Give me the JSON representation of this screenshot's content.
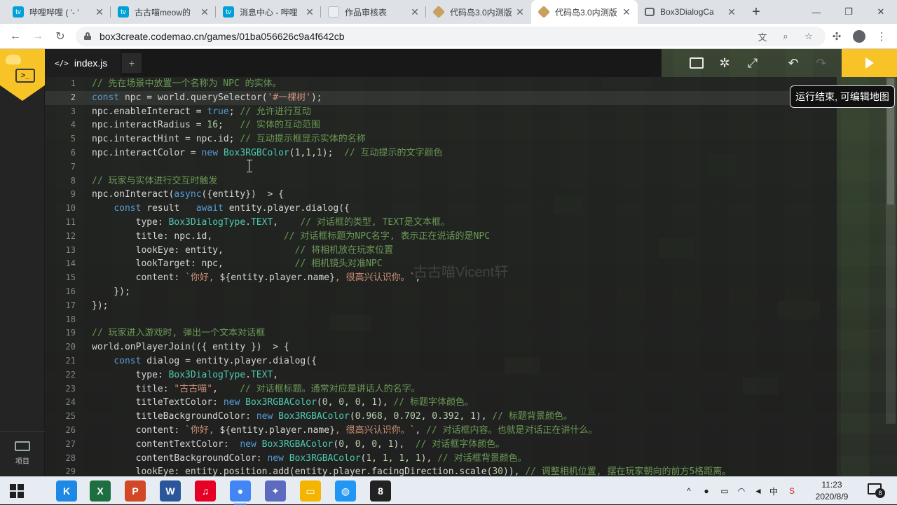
{
  "browser": {
    "tabs": [
      {
        "title": "哔哩哔哩 ( '- '",
        "icon": "bilibili-icon",
        "color": "#00a1d6"
      },
      {
        "title": "古古喵meow的",
        "icon": "bilibili-icon",
        "color": "#00a1d6"
      },
      {
        "title": "消息中心 - 哔哩",
        "icon": "bilibili-icon",
        "color": "#00a1d6"
      },
      {
        "title": "作品审核表",
        "icon": "document-icon",
        "color": "#cfd8dc"
      },
      {
        "title": "代码岛3.0内测版",
        "icon": "box3-icon",
        "color": "#c8a060"
      },
      {
        "title": "代码岛3.0内测版",
        "icon": "box3-icon",
        "color": "#c8a060"
      },
      {
        "title": "Box3DialogCa",
        "icon": "book-icon",
        "color": "#5f6368"
      }
    ],
    "url": "box3create.codemao.cn/games/01ba056626c9a4f642cb"
  },
  "editor": {
    "file_tab": "index.js",
    "file_tab_add": "+",
    "tooltip": "运行结束, 可编辑地图",
    "watermark": "古古喵Vicent轩",
    "left_rail_label": "项目",
    "lines": [
      {
        "n": "1",
        "segs": [
          [
            "cm",
            "// 先在场景中放置一个名称为 NPC 的实体。"
          ]
        ]
      },
      {
        "n": "2",
        "segs": [
          [
            "kw",
            "const"
          ],
          [
            "",
            " npc = world.querySelector("
          ],
          [
            "str",
            "'#一棵树'"
          ],
          [
            "",
            ");"
          ]
        ]
      },
      {
        "n": "3",
        "segs": [
          [
            "",
            "npc.enableInteract = "
          ],
          [
            "kw",
            "true"
          ],
          [
            "",
            "; "
          ],
          [
            "cm",
            "// 允许进行互动"
          ]
        ]
      },
      {
        "n": "4",
        "segs": [
          [
            "",
            "npc.interactRadius = "
          ],
          [
            "num",
            "16"
          ],
          [
            "",
            ";   "
          ],
          [
            "cm",
            "// 实体的互动范围"
          ]
        ]
      },
      {
        "n": "5",
        "segs": [
          [
            "",
            "npc.interactHint = npc.id; "
          ],
          [
            "cm",
            "// 互动提示框显示实体的名称"
          ]
        ]
      },
      {
        "n": "6",
        "segs": [
          [
            "",
            "npc.interactColor = "
          ],
          [
            "kw",
            "new"
          ],
          [
            "",
            " "
          ],
          [
            "ty",
            "Box3RGBColor"
          ],
          [
            "",
            "("
          ],
          [
            "num",
            "1"
          ],
          [
            "",
            ","
          ],
          [
            "num",
            "1"
          ],
          [
            "",
            ","
          ],
          [
            "num",
            "1"
          ],
          [
            "",
            ");  "
          ],
          [
            "cm",
            "// 互动提示的文字颜色"
          ]
        ]
      },
      {
        "n": "7",
        "segs": [
          [
            "",
            ""
          ]
        ]
      },
      {
        "n": "8",
        "segs": [
          [
            "cm",
            "// 玩家与实体进行交互时触发"
          ]
        ]
      },
      {
        "n": "9",
        "segs": [
          [
            "",
            "npc.onInteract("
          ],
          [
            "kw",
            "async"
          ],
          [
            "",
            "({entity})  > {"
          ]
        ]
      },
      {
        "n": "10",
        "segs": [
          [
            "",
            "    "
          ],
          [
            "kw",
            "const"
          ],
          [
            "",
            " result   "
          ],
          [
            "kw",
            "await"
          ],
          [
            "",
            " entity.player.dialog({"
          ]
        ]
      },
      {
        "n": "11",
        "segs": [
          [
            "",
            "        type: "
          ],
          [
            "ty",
            "Box3DialogType"
          ],
          [
            "",
            "."
          ],
          [
            "ty",
            "TEXT"
          ],
          [
            "",
            ",    "
          ],
          [
            "cm",
            "// 对话框的类型, TEXT是文本框。"
          ]
        ]
      },
      {
        "n": "12",
        "segs": [
          [
            "",
            "        title: npc.id,             "
          ],
          [
            "cm",
            "// 对话框标题为NPC名字, 表示正在说话的是NPC"
          ]
        ]
      },
      {
        "n": "13",
        "segs": [
          [
            "",
            "        lookEye: entity,             "
          ],
          [
            "cm",
            "// 将相机放在玩家位置"
          ]
        ]
      },
      {
        "n": "14",
        "segs": [
          [
            "",
            "        lookTarget: npc,             "
          ],
          [
            "cm",
            "// 相机镜头对准NPC"
          ]
        ]
      },
      {
        "n": "15",
        "segs": [
          [
            "",
            "        content: "
          ],
          [
            "str",
            "`你好, "
          ],
          [
            "",
            "${entity.player.name}"
          ],
          [
            "str",
            ", 很高兴认识你。`"
          ],
          [
            "",
            ","
          ]
        ]
      },
      {
        "n": "16",
        "segs": [
          [
            "",
            "    });"
          ]
        ]
      },
      {
        "n": "17",
        "segs": [
          [
            "",
            "});"
          ]
        ]
      },
      {
        "n": "18",
        "segs": [
          [
            "",
            ""
          ]
        ]
      },
      {
        "n": "19",
        "segs": [
          [
            "cm",
            "// 玩家进入游戏时, 弹出一个文本对话框"
          ]
        ]
      },
      {
        "n": "20",
        "segs": [
          [
            "",
            "world.onPlayerJoin(({ entity })  > {"
          ]
        ]
      },
      {
        "n": "21",
        "segs": [
          [
            "",
            "    "
          ],
          [
            "kw",
            "const"
          ],
          [
            "",
            " dialog = entity.player.dialog({"
          ]
        ]
      },
      {
        "n": "22",
        "segs": [
          [
            "",
            "        type: "
          ],
          [
            "ty",
            "Box3DialogType"
          ],
          [
            "",
            "."
          ],
          [
            "ty",
            "TEXT"
          ],
          [
            "",
            ","
          ]
        ]
      },
      {
        "n": "23",
        "segs": [
          [
            "",
            "        title: "
          ],
          [
            "str",
            "\"古古喵\""
          ],
          [
            "",
            ",    "
          ],
          [
            "cm",
            "// 对话框标题。通常对应是讲话人的名字。"
          ]
        ]
      },
      {
        "n": "24",
        "segs": [
          [
            "",
            "        titleTextColor: "
          ],
          [
            "kw",
            "new"
          ],
          [
            "",
            " "
          ],
          [
            "ty",
            "Box3RGBAColor"
          ],
          [
            "",
            "("
          ],
          [
            "num",
            "0"
          ],
          [
            "",
            ", "
          ],
          [
            "num",
            "0"
          ],
          [
            "",
            ", "
          ],
          [
            "num",
            "0"
          ],
          [
            "",
            ", "
          ],
          [
            "num",
            "1"
          ],
          [
            "",
            "), "
          ],
          [
            "cm",
            "// 标题字体颜色。"
          ]
        ]
      },
      {
        "n": "25",
        "segs": [
          [
            "",
            "        titleBackgroundColor: "
          ],
          [
            "kw",
            "new"
          ],
          [
            "",
            " "
          ],
          [
            "ty",
            "Box3RGBAColor"
          ],
          [
            "",
            "("
          ],
          [
            "num",
            "0.968"
          ],
          [
            "",
            ", "
          ],
          [
            "num",
            "0.702"
          ],
          [
            "",
            ", "
          ],
          [
            "num",
            "0.392"
          ],
          [
            "",
            ", "
          ],
          [
            "num",
            "1"
          ],
          [
            "",
            "), "
          ],
          [
            "cm",
            "// 标题背景颜色。"
          ]
        ]
      },
      {
        "n": "26",
        "segs": [
          [
            "",
            "        content: "
          ],
          [
            "str",
            "`你好, "
          ],
          [
            "",
            "${entity.player.name}"
          ],
          [
            "str",
            ", 很高兴认识你。`"
          ],
          [
            "",
            ", "
          ],
          [
            "cm",
            "// 对话框内容。也就是对话正在讲什么。"
          ]
        ]
      },
      {
        "n": "27",
        "segs": [
          [
            "",
            "        contentTextColor:  "
          ],
          [
            "kw",
            "new"
          ],
          [
            "",
            " "
          ],
          [
            "ty",
            "Box3RGBAColor"
          ],
          [
            "",
            "("
          ],
          [
            "num",
            "0"
          ],
          [
            "",
            ", "
          ],
          [
            "num",
            "0"
          ],
          [
            "",
            ", "
          ],
          [
            "num",
            "0"
          ],
          [
            "",
            ", "
          ],
          [
            "num",
            "1"
          ],
          [
            "",
            "),  "
          ],
          [
            "cm",
            "// 对话框字体颜色。"
          ]
        ]
      },
      {
        "n": "28",
        "segs": [
          [
            "",
            "        contentBackgroundColor: "
          ],
          [
            "kw",
            "new"
          ],
          [
            "",
            " "
          ],
          [
            "ty",
            "Box3RGBAColor"
          ],
          [
            "",
            "("
          ],
          [
            "num",
            "1"
          ],
          [
            "",
            ", "
          ],
          [
            "num",
            "1"
          ],
          [
            "",
            ", "
          ],
          [
            "num",
            "1"
          ],
          [
            "",
            ", "
          ],
          [
            "num",
            "1"
          ],
          [
            "",
            "), "
          ],
          [
            "cm",
            "// 对话框背景颜色。"
          ]
        ]
      },
      {
        "n": "29",
        "segs": [
          [
            "",
            "        lookEye: entity.position.add(entity.player.facingDirection.scale("
          ],
          [
            "num",
            "30"
          ],
          [
            "",
            ")), "
          ],
          [
            "cm",
            "// 调整相机位置, 摆在玩家朝向的前方5格距离。"
          ]
        ]
      }
    ]
  },
  "taskbar": {
    "apps": [
      {
        "name": "kuaishou-app-icon",
        "glyph": "K",
        "color": "#1e88e5"
      },
      {
        "name": "excel-app-icon",
        "glyph": "X",
        "color": "#1d6f42"
      },
      {
        "name": "powerpoint-app-icon",
        "glyph": "P",
        "color": "#d24726"
      },
      {
        "name": "word-app-icon",
        "glyph": "W",
        "color": "#2b579a"
      },
      {
        "name": "netease-music-app-icon",
        "glyph": "♫",
        "color": "#e60026"
      },
      {
        "name": "chrome-app-icon",
        "glyph": "●",
        "color": "#4285f4"
      },
      {
        "name": "feather-app-icon",
        "glyph": "✦",
        "color": "#5c6bc0"
      },
      {
        "name": "file-explorer-app-icon",
        "glyph": "▭",
        "color": "#f4b400"
      },
      {
        "name": "browser-globe-app-icon",
        "glyph": "◍",
        "color": "#2196f3"
      },
      {
        "name": "video-editor-app-icon",
        "glyph": "8",
        "color": "#222222"
      }
    ],
    "tray_ime": "中",
    "time": "11:23",
    "date": "2020/8/9",
    "notif_count": "8"
  }
}
